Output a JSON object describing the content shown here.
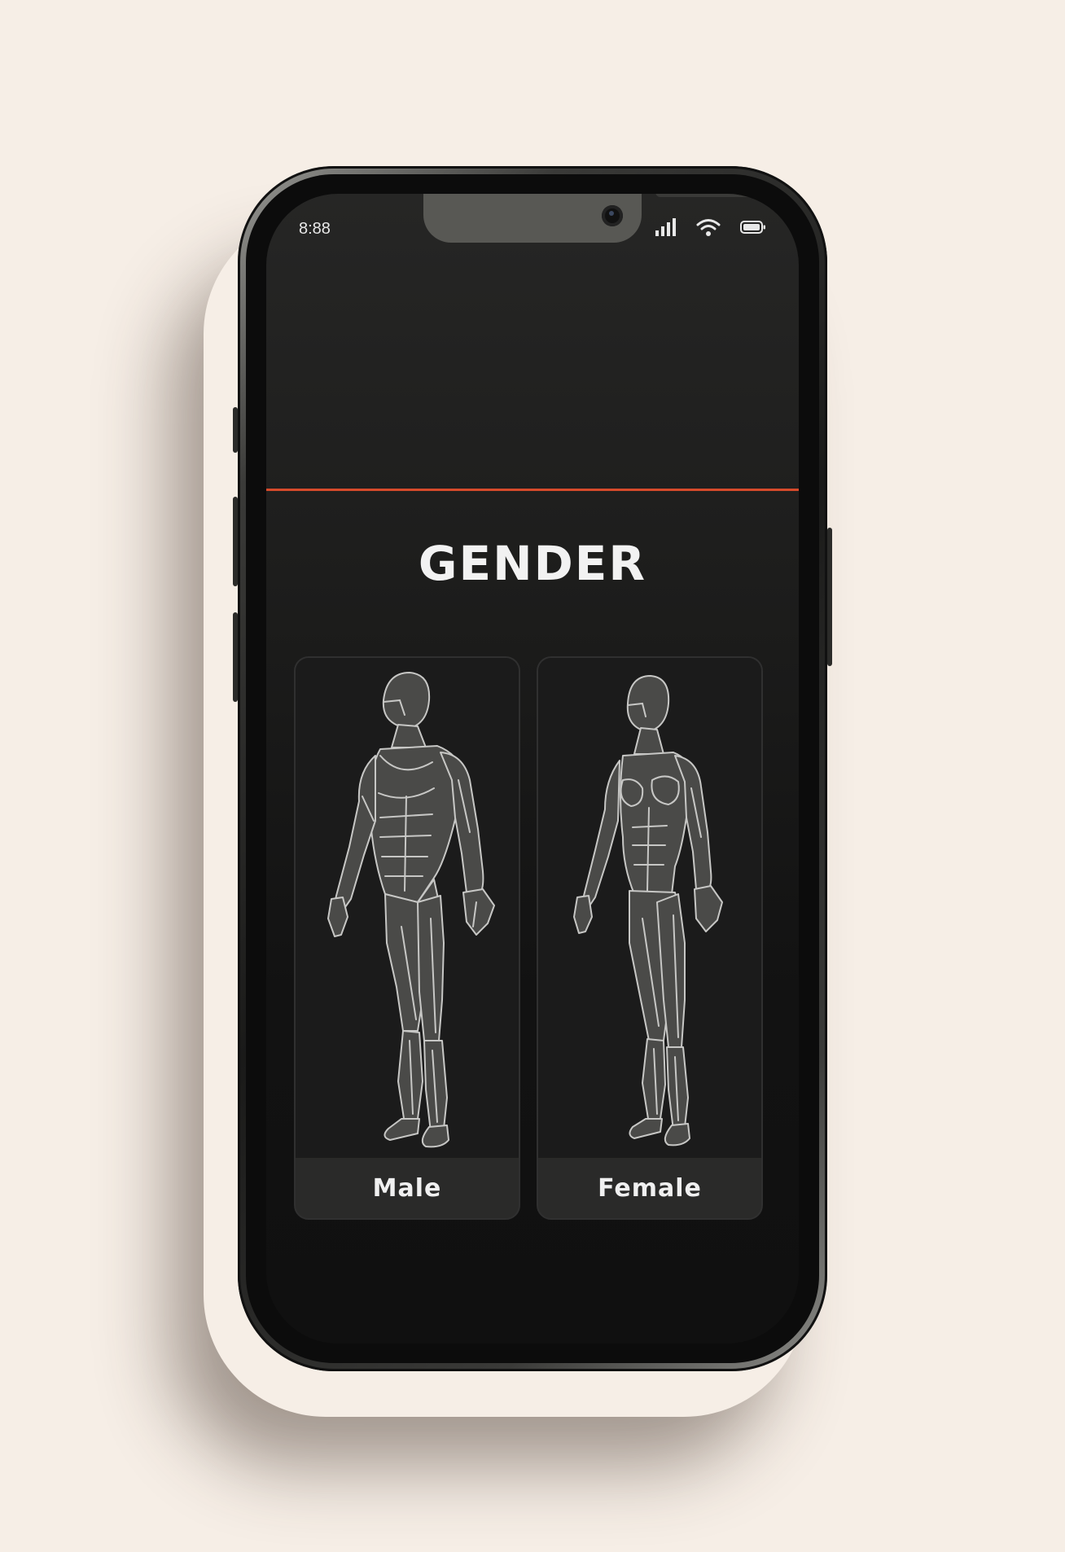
{
  "status_bar": {
    "time": "8:88",
    "icons": [
      "signal-icon",
      "wifi-icon",
      "battery-icon"
    ]
  },
  "header": {
    "accent_color": "#d64a2b"
  },
  "page": {
    "title": "GENDER"
  },
  "options": [
    {
      "label": "Male",
      "illustration": "male-anatomy-figure"
    },
    {
      "label": "Female",
      "illustration": "female-anatomy-figure"
    }
  ],
  "colors": {
    "background": "#f6eee6",
    "screen": "#1e1e1d",
    "card": "#2a2a29",
    "text": "#f2f2f2"
  }
}
